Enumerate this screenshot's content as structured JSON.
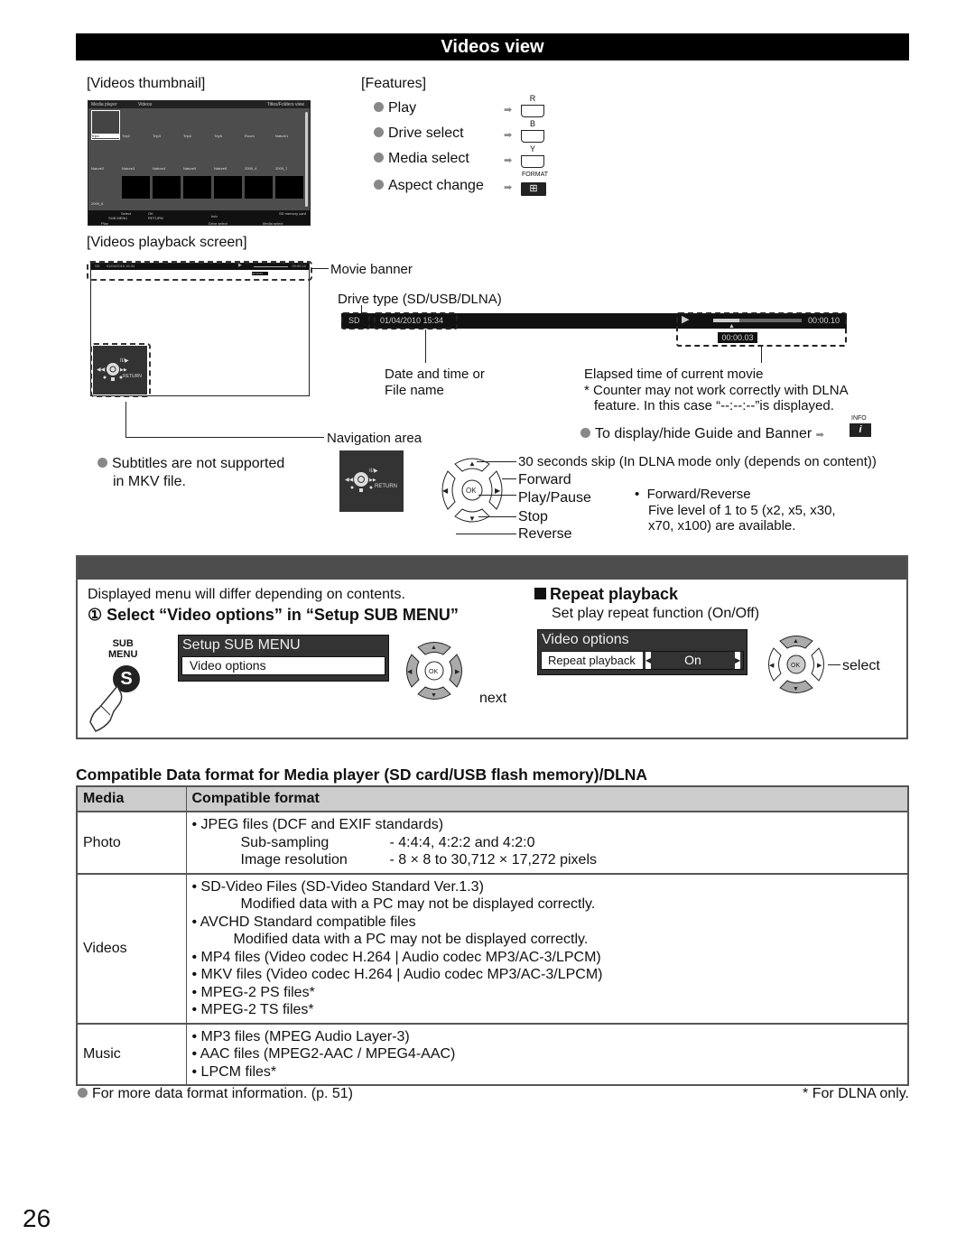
{
  "page": {
    "title": "Videos view",
    "page_number": "26"
  },
  "thumbnail_section": {
    "label": "[Videos thumbnail]",
    "screen": {
      "header_left": "Media player",
      "header_mid": "Videos",
      "header_right": "Titles/Folders view",
      "row1": [
        "Trip1",
        "Trip2",
        "Trip3",
        "Trip4",
        "Trip5",
        "Room",
        "Nature1"
      ],
      "row2": [
        "Nature2",
        "Nature3",
        "Nature4",
        "Nature5",
        "Nature6",
        "2009_4",
        "2009_7"
      ],
      "row3": [
        "2009_8"
      ],
      "footer": {
        "select": "Select",
        "ok": "OK",
        "sub_menu": "SUB MENU",
        "return": "RETURN",
        "info": "Info",
        "drive": "SD memory card",
        "play": "Play",
        "drive_select": "Drive select",
        "media_select": "Media select"
      }
    }
  },
  "features": {
    "label": "[Features]",
    "items": [
      {
        "label": "Play",
        "key": "R",
        "icon": "red-button-icon"
      },
      {
        "label": "Drive select",
        "key": "B",
        "icon": "blue-button-icon"
      },
      {
        "label": "Media select",
        "key": "Y",
        "icon": "yellow-button-icon"
      },
      {
        "label": "Aspect change",
        "key": "FORMAT",
        "icon": "format-button-icon"
      }
    ]
  },
  "playback_section": {
    "label": "[Videos playback screen]",
    "mini_banner": {
      "drive": "SD",
      "datetime": "01/04/2010 15:34",
      "time": "00:00.10",
      "elapsed": "00:00.03"
    },
    "mini_nav_return": "RETURN",
    "callouts": {
      "movie_banner": "Movie banner",
      "drive_type": "Drive type (SD/USB/DLNA)",
      "date_time_1": "Date and time or",
      "date_time_2": "File name",
      "elapsed_title": "Elapsed time of current movie",
      "elapsed_note_1": "* Counter may not work correctly with DLNA",
      "elapsed_note_2": "feature. In this case “--:--:--”is displayed.",
      "navigation_area": "Navigation area",
      "info_tip": "To display/hide Guide and Banner",
      "info_key_label": "INFO"
    },
    "banner": {
      "drive": "SD",
      "datetime": "01/04/2010  15:34",
      "total_time": "00:00.10",
      "elapsed": "00:00.03",
      "progress": 0.3
    }
  },
  "navigation": {
    "subtitle_note_1": "Subtitles are not supported",
    "subtitle_note_2": "in MKV file.",
    "nav_return": "RETURN",
    "ok_label": "OK",
    "controls": {
      "up": "30 seconds skip (In DLNA mode only (depends on content))",
      "right": "Forward",
      "ok": "Play/Pause",
      "down": "Stop",
      "left": "Reverse"
    },
    "ff_note_title": "Forward/Reverse",
    "ff_note_1": "Five level of 1 to 5 (x2, x5, x30,",
    "ff_note_2": "x70, x100) are available."
  },
  "panel": {
    "intro": "Displayed menu will differ depending on contents.",
    "step1": "① Select “Video options” in “Setup SUB MENU”",
    "sub_menu_key_1": "SUB",
    "sub_menu_key_2": "MENU",
    "sub_menu_key_letter": "S",
    "setup_menu_title": "Setup SUB MENU",
    "setup_menu_item": "Video options",
    "next_label": "next",
    "ok_label": "OK",
    "repeat_title": "Repeat playback",
    "repeat_desc": "Set play repeat function (On/Off)",
    "video_options_title": "Video options",
    "repeat_item_label": "Repeat playback",
    "repeat_item_value": "On",
    "select_label": "select"
  },
  "format_table": {
    "title": "Compatible Data format for Media player (SD card/USB flash memory)/DLNA",
    "headers": [
      "Media",
      "Compatible format"
    ],
    "photo": {
      "media": "Photo",
      "line1": "• JPEG files (DCF and EXIF standards)",
      "sub": [
        {
          "k": "Sub-sampling",
          "v": "- 4:4:4, 4:2:2 and 4:2:0"
        },
        {
          "k": "Image resolution",
          "v": "- 8 × 8 to 30,712 × 17,272 pixels"
        }
      ]
    },
    "videos": {
      "media": "Videos",
      "lines": [
        "• SD-Video Files (SD-Video Standard Ver.1.3)",
        "Modified data with a PC may not be displayed correctly.",
        "• AVCHD Standard compatible files",
        "Modified data with a PC may not be displayed correctly.",
        "• MP4 files (Video codec H.264 | Audio codec MP3/AC-3/LPCM)",
        "• MKV files (Video codec H.264 | Audio codec MP3/AC-3/LPCM)",
        "• MPEG-2 PS files*",
        "• MPEG-2 TS files*"
      ]
    },
    "music": {
      "media": "Music",
      "lines": [
        "• MP3 files (MPEG Audio Layer-3)",
        "• AAC files (MPEG2-AAC / MPEG4-AAC)",
        "• LPCM files*"
      ]
    }
  },
  "footer": {
    "more_info": "For more data format information. (p. 51)",
    "dlna_note": "* For DLNA only."
  }
}
